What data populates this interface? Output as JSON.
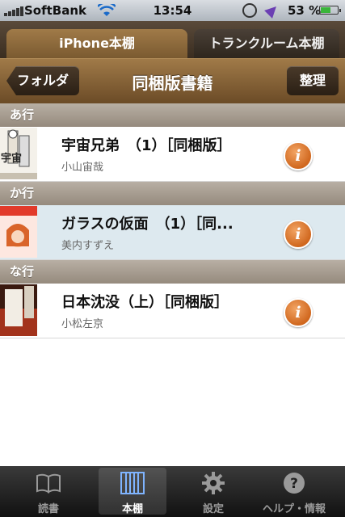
{
  "status_bar": {
    "carrier": "SoftBank",
    "time": "13:54",
    "battery": "53 %",
    "battery_level": 0.53,
    "icons": [
      "signal-icon",
      "wifi-icon",
      "rotation-lock-icon",
      "location-icon",
      "battery-icon"
    ]
  },
  "top_tabs": [
    {
      "label": "iPhone本棚",
      "active": true
    },
    {
      "label": "トランクルーム本棚",
      "active": false
    }
  ],
  "nav": {
    "back_label": "フォルダ",
    "title": "同梱版書籍",
    "edit_label": "整理"
  },
  "sections": [
    {
      "header": "あ行",
      "items": [
        {
          "title": "宇宙兄弟　（1）［同梱版］",
          "author": "小山宙哉",
          "selected": false
        }
      ]
    },
    {
      "header": "か行",
      "items": [
        {
          "title": "ガラスの仮面　（1）［同...",
          "author": "美内すずえ",
          "selected": true
        }
      ]
    },
    {
      "header": "な行",
      "items": [
        {
          "title": "日本沈没（上）［同梱版］",
          "author": "小松左京",
          "selected": false
        }
      ]
    }
  ],
  "bottom_tabs": [
    {
      "label": "読書",
      "icon": "book-icon",
      "active": false
    },
    {
      "label": "本棚",
      "icon": "bookshelf-icon",
      "active": true
    },
    {
      "label": "設定",
      "icon": "gear-icon",
      "active": false
    },
    {
      "label": "ヘルプ・情報",
      "icon": "help-icon",
      "active": false
    }
  ],
  "colors": {
    "accent": "#8a6a3e",
    "info_button": "#d9732a",
    "selected_row": "#dde9ef"
  }
}
